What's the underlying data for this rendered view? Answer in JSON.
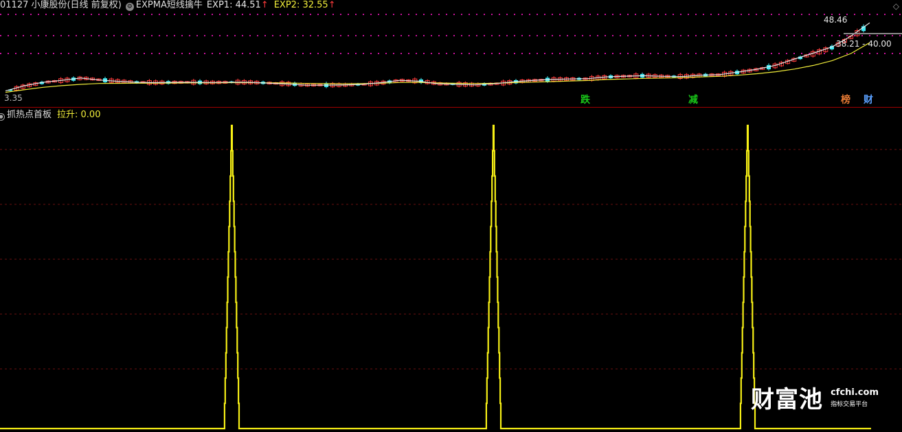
{
  "header": {
    "stock": "01127 小康股份(日线 前复权)",
    "indicator_name": "EXPMA短线擒牛",
    "exp1_label": "EXP1: 44.51",
    "exp2_label": "EXP2: 32.55",
    "up_arrow": "↑",
    "settings_icon": "gear-icon",
    "corner_icon": "diamond-icon"
  },
  "price_labels": {
    "high": "48.46",
    "low": "3.35",
    "range": "38.21 - 40.00"
  },
  "event_tags": [
    {
      "text": "跌",
      "color": "#19c819"
    },
    {
      "text": "减",
      "color": "#19c819"
    },
    {
      "text": "榜",
      "color": "#e87b34"
    },
    {
      "text": "财",
      "color": "#5aa0ff"
    }
  ],
  "sub_header": {
    "indicator_name": "抓热点首板",
    "value_label": "拉升: 0.00"
  },
  "colors": {
    "background": "#000000",
    "grid_dot": "#c8139c",
    "sub_grid": "#6d1010",
    "divider": "#a00000",
    "bull": "#ff3c3c",
    "bear": "#41ebf5",
    "exp1": "#e8e8e8",
    "exp2": "#f2ee3a",
    "signal": "#f7f016"
  },
  "watermark": {
    "name": "财富池",
    "domain": "cfchi.com",
    "slogan": "指标交易平台"
  },
  "chart_data": [
    {
      "type": "line",
      "title": "EXPMA短线擒牛",
      "series": [
        {
          "name": "EXP1",
          "last": 44.51,
          "values": [
            3.4,
            6.5,
            8.6,
            9.8,
            11.2,
            10.0,
            9.2,
            8.6,
            8.4,
            8.6,
            8.6,
            8.5,
            8.7,
            8.6,
            8.1,
            7.6,
            6.9,
            6.9,
            7.0,
            7.4,
            8.4,
            9.8,
            9.3,
            7.7,
            7.4,
            7.1,
            7.7,
            8.9,
            9.7,
            10.3,
            10.6,
            10.8,
            11.9,
            12.3,
            12.6,
            12.2,
            12.1,
            12.9,
            13.2,
            14.8,
            16.5,
            18.9,
            22.7,
            26.2,
            30.0,
            36.5,
            44.51
          ]
        },
        {
          "name": "EXP2",
          "last": 32.55,
          "values": [
            2.6,
            4.1,
            5.6,
            6.6,
            7.4,
            7.9,
            8.0,
            8.1,
            8.1,
            8.2,
            8.3,
            8.3,
            8.4,
            8.4,
            8.3,
            8.2,
            7.9,
            7.8,
            7.7,
            7.8,
            8.1,
            8.5,
            8.6,
            8.2,
            8.0,
            7.9,
            8.0,
            8.4,
            8.7,
            9.0,
            9.4,
            9.7,
            10.3,
            10.6,
            11.0,
            11.2,
            11.4,
            11.9,
            12.2,
            12.9,
            13.8,
            15.0,
            16.6,
            18.8,
            21.7,
            26.0,
            32.55
          ]
        }
      ]
    },
    {
      "type": "line",
      "title": "抓热点首板",
      "series": [
        {
          "name": "拉升",
          "last": 0.0,
          "peaks": [
            {
              "x": 337,
              "value": 100
            },
            {
              "x": 718,
              "value": 100
            },
            {
              "x": 1088,
              "value": 100
            }
          ]
        }
      ],
      "ylim": [
        0,
        100
      ]
    }
  ]
}
